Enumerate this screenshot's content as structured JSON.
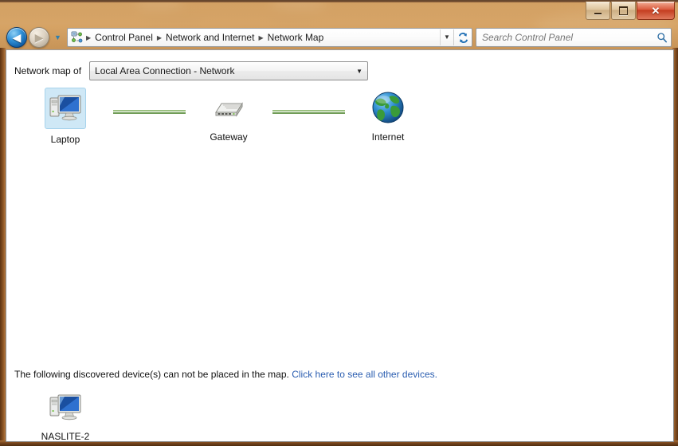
{
  "window": {
    "caption_buttons": [
      {
        "name": "minimize",
        "glyph": "minimize-icon",
        "label": "Minimize"
      },
      {
        "name": "maximize",
        "glyph": "maximize-icon",
        "label": "Maximize"
      },
      {
        "name": "close",
        "glyph": "close-icon",
        "label": "Close"
      }
    ]
  },
  "nav": {
    "back_label": "◀",
    "forward_label": "◀",
    "recent_chevron": "▼",
    "address_icon": "network-map-icon",
    "breadcrumb": [
      {
        "label": "Control Panel"
      },
      {
        "label": "Network and Internet"
      },
      {
        "label": "Network Map"
      }
    ],
    "breadcrumb_separator": "▶",
    "address_dropdown": "▼",
    "refresh_icon": "refresh-icon"
  },
  "search": {
    "placeholder": "Search Control Panel",
    "value": "",
    "icon": "search-icon"
  },
  "map_toolbar": {
    "label": "Network map of",
    "selected_network": "Local Area Connection - Network",
    "dropdown_arrow": "▼",
    "options": [
      "Local Area Connection - Network"
    ]
  },
  "topology": {
    "nodes": [
      {
        "label": "Laptop",
        "icon": "computer-icon",
        "selected": true
      },
      {
        "label": "Gateway",
        "icon": "router-icon",
        "selected": false
      },
      {
        "label": "Internet",
        "icon": "globe-icon",
        "selected": false
      }
    ],
    "links": [
      {
        "from": "Laptop",
        "to": "Gateway",
        "status": "connected"
      },
      {
        "from": "Gateway",
        "to": "Internet",
        "status": "connected"
      }
    ],
    "link_color_light": "#9bc081",
    "link_color_dark": "#6f9c55"
  },
  "other_devices": {
    "note_text": "The following discovered device(s) can not be placed in the map.",
    "link_text": "Click here to see all other devices.",
    "link_color": "#2a5db0",
    "devices": [
      {
        "label": "NASLITE-2",
        "icon": "computer-icon"
      }
    ]
  },
  "colors": {
    "glass_frame": "#d29c5c",
    "close_button": "#c33b1e",
    "selection_highlight": "#cfe8f6",
    "content_background": "#ffffff"
  }
}
